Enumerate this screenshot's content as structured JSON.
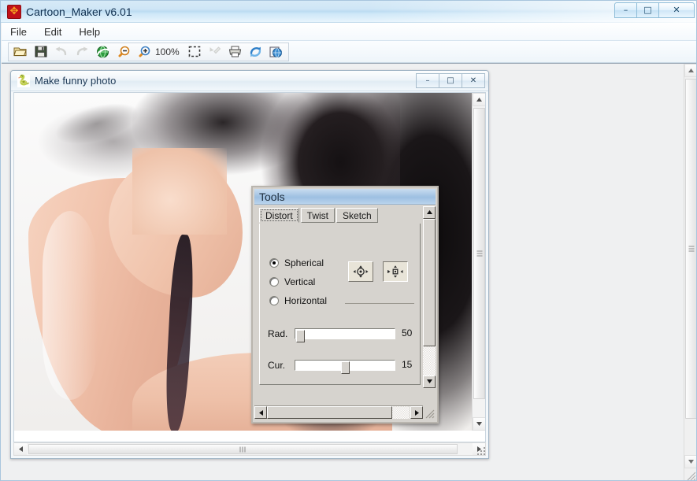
{
  "app": {
    "title": "Cartoon_Maker v6.01",
    "icon": "app-logo-icon",
    "window_controls": {
      "minimize": "–",
      "maximize": "□",
      "close": "✕"
    }
  },
  "menubar": {
    "items": [
      {
        "label": "File",
        "name": "menu-file"
      },
      {
        "label": "Edit",
        "name": "menu-edit"
      },
      {
        "label": "Help",
        "name": "menu-help"
      }
    ]
  },
  "toolbar": {
    "zoom_level": "100%",
    "buttons": [
      {
        "name": "open-file-icon",
        "title": "Open",
        "enabled": true
      },
      {
        "name": "save-file-icon",
        "title": "Save",
        "enabled": true
      },
      {
        "name": "undo-icon",
        "title": "Undo",
        "enabled": false
      },
      {
        "name": "redo-icon",
        "title": "Redo",
        "enabled": false
      },
      {
        "name": "refresh-globe-icon",
        "title": "Refresh",
        "enabled": true
      },
      {
        "name": "zoom-out-icon",
        "title": "Zoom Out",
        "enabled": true
      },
      {
        "name": "zoom-in-icon",
        "title": "Zoom In",
        "enabled": true
      },
      {
        "name": "select-region-icon",
        "title": "Select",
        "enabled": true
      },
      {
        "name": "eyedropper-icon",
        "title": "Pick Color",
        "enabled": false
      },
      {
        "name": "print-icon",
        "title": "Print",
        "enabled": true
      },
      {
        "name": "recycle-icon",
        "title": "Reset",
        "enabled": true
      },
      {
        "name": "export-icon",
        "title": "Export",
        "enabled": true
      }
    ]
  },
  "child_window": {
    "title": "Make funny photo",
    "icon": "dragon-icon",
    "controls": {
      "minimize": "–",
      "maximize": "□",
      "close": "✕"
    },
    "canvas_alt": "photo of a woman with long dark hair raising her arm"
  },
  "tools_dialog": {
    "title": "Tools",
    "tabs": [
      {
        "label": "Distort",
        "active": true
      },
      {
        "label": "Twist",
        "active": false
      },
      {
        "label": "Sketch",
        "active": false
      }
    ],
    "radios": [
      {
        "label": "Spherical",
        "selected": true
      },
      {
        "label": "Vertical",
        "selected": false
      },
      {
        "label": "Horizontal",
        "selected": false
      }
    ],
    "mode_buttons": [
      {
        "name": "expand-outward-icon",
        "state": "raised"
      },
      {
        "name": "pinch-inward-icon",
        "state": "sunken"
      }
    ],
    "sliders": [
      {
        "label": "Rad.",
        "value": "50",
        "thumb_percent": 3
      },
      {
        "label": "Cur.",
        "value": "15",
        "thumb_percent": 60
      }
    ]
  },
  "colors": {
    "aero_title": "#cfe6f6",
    "classic_face": "#d6d3ce",
    "tools_header": "#9dc0e2",
    "accent_red": "#c1121a",
    "text_dark": "#1d2c3c"
  }
}
